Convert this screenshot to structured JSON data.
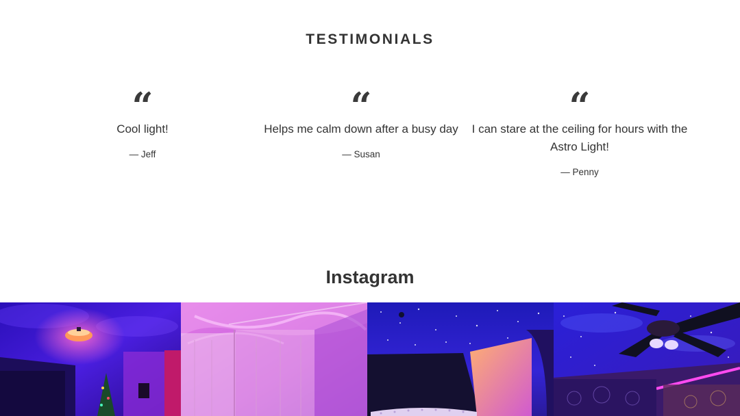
{
  "testimonials": {
    "title": "TESTIMONIALS",
    "quote_mark": "“",
    "items": [
      {
        "text": "Cool light!",
        "author": "— Jeff"
      },
      {
        "text": "Helps me calm down after a busy day",
        "author": "— Susan"
      },
      {
        "text": "I can stare at the ceiling for hours with the Astro Light!",
        "author": "— Penny"
      }
    ]
  },
  "instagram": {
    "title": "Instagram",
    "photos": [
      {
        "subject": "bedroom with galaxy light projection and ceiling lamp",
        "dominant_color": "#3b16c9"
      },
      {
        "subject": "curtains lit by pink aurora projection",
        "dominant_color": "#d86be0"
      },
      {
        "subject": "starry ceiling over bed headboard",
        "dominant_color": "#2a22c4"
      },
      {
        "subject": "ceiling fan with star projection and LED strip",
        "dominant_color": "#2b1fd1"
      }
    ]
  },
  "colors": {
    "text": "#333333",
    "background": "#ffffff"
  }
}
